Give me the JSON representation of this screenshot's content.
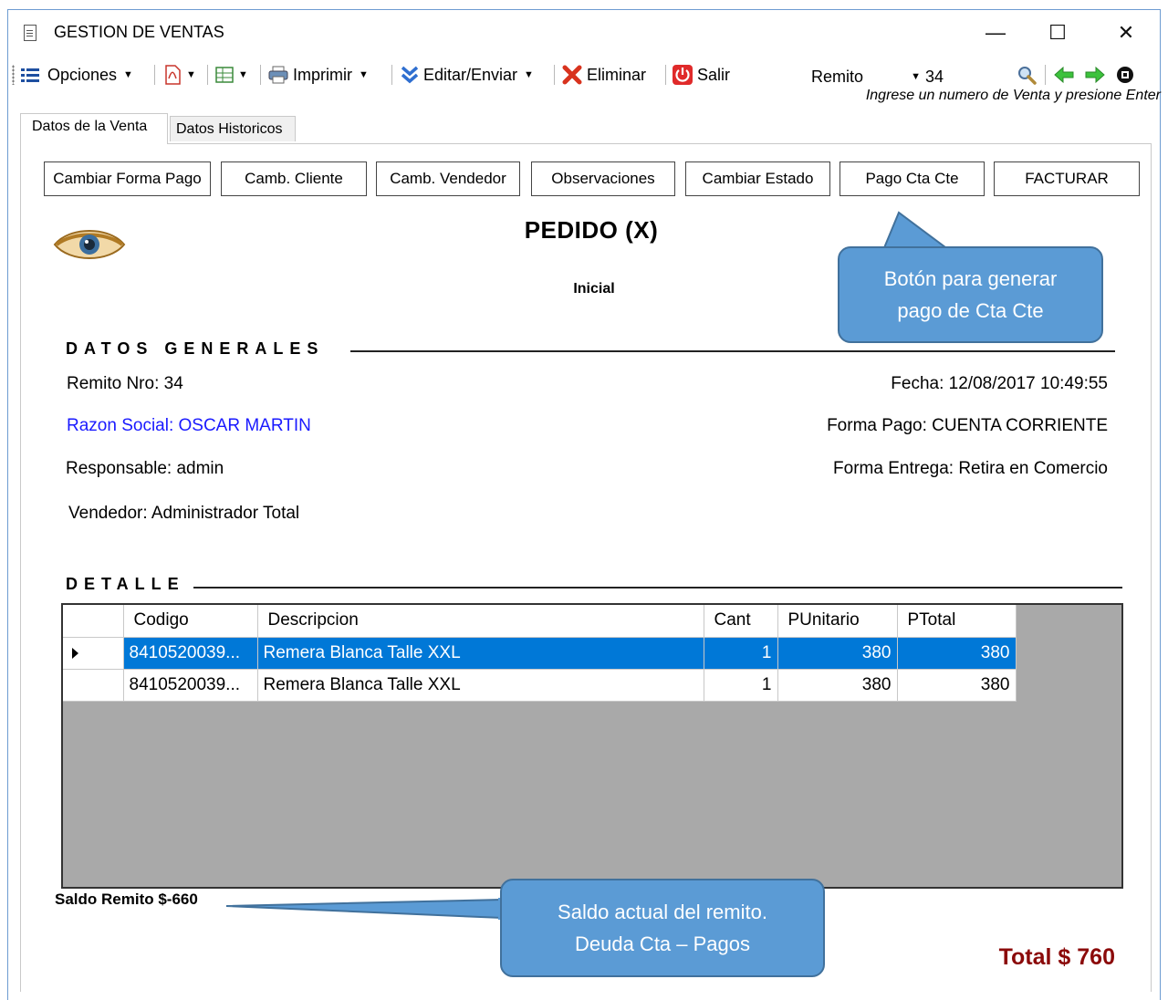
{
  "window": {
    "title": "GESTION DE VENTAS",
    "controls": {
      "minimize": "—",
      "maximize": "☐",
      "close": "✕"
    }
  },
  "toolbar": {
    "opciones": "Opciones",
    "imprimir": "Imprimir",
    "editar_enviar": "Editar/Enviar",
    "eliminar": "Eliminar",
    "salir": "Salir",
    "doc_type": "Remito",
    "doc_number": "34",
    "hint": "Ingrese un numero de Venta y presione Enter",
    "icons": [
      "list-icon",
      "pdf-icon",
      "excel-icon",
      "printer-icon",
      "chevron-double-down-icon",
      "delete-x-icon",
      "power-icon",
      "search-icon",
      "arrow-left-icon",
      "arrow-right-icon",
      "stop-icon"
    ]
  },
  "tabs": [
    {
      "label": "Datos de la Venta",
      "active": true
    },
    {
      "label": "Datos Historicos",
      "active": false
    }
  ],
  "actions": {
    "cambiar_forma_pago": "Cambiar Forma Pago",
    "camb_cliente": "Camb. Cliente",
    "camb_vendedor": "Camb. Vendedor",
    "observaciones": "Observaciones",
    "cambiar_estado": "Cambiar Estado",
    "pago_cta_cte": "Pago Cta Cte",
    "facturar": "FACTURAR"
  },
  "report": {
    "title": "PEDIDO (X)",
    "status": "Inicial",
    "section_general": "DATOS GENERALES",
    "remito": "Remito Nro: 34",
    "razon_social": "Razon Social: OSCAR MARTIN",
    "responsable": "Responsable: admin",
    "vendedor": "Vendedor: Administrador Total",
    "fecha": "Fecha: 12/08/2017 10:49:55",
    "forma_pago": "Forma Pago: CUENTA CORRIENTE",
    "forma_entrega": "Forma Entrega: Retira en Comercio",
    "section_detalle": "DETALLE",
    "saldo": "Saldo Remito $-660",
    "total": "Total $ 760"
  },
  "grid": {
    "columns": [
      "Codigo",
      "Descripcion",
      "Cant",
      "PUnitario",
      "PTotal"
    ],
    "rows": [
      {
        "codigo": "8410520039...",
        "descripcion": "Remera Blanca Talle XXL",
        "cant": "1",
        "punitario": "380",
        "ptotal": "380",
        "selected": true
      },
      {
        "codigo": "8410520039...",
        "descripcion": "Remera Blanca Talle XXL",
        "cant": "1",
        "punitario": "380",
        "ptotal": "380",
        "selected": false
      }
    ]
  },
  "callouts": {
    "pago_line1": "Botón para generar",
    "pago_line2": "pago de Cta Cte",
    "saldo_line1": "Saldo actual del remito.",
    "saldo_line2": "Deuda Cta – Pagos"
  },
  "colors": {
    "accent_blue": "#0078d7",
    "callout_fill": "#5b9bd5",
    "callout_border": "#41719c",
    "razon_social_text": "#1a1aff",
    "total_text": "#8b0a0a"
  }
}
